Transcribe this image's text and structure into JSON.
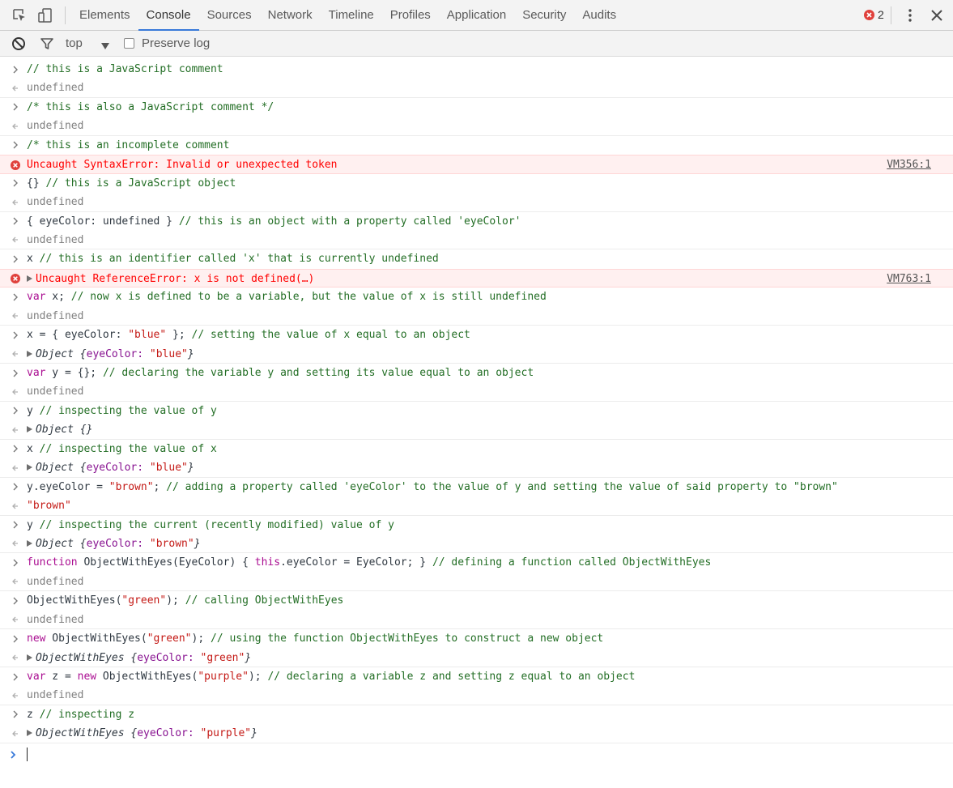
{
  "tabs": [
    {
      "label": "Elements"
    },
    {
      "label": "Console",
      "selected": true
    },
    {
      "label": "Sources"
    },
    {
      "label": "Network"
    },
    {
      "label": "Timeline"
    },
    {
      "label": "Profiles"
    },
    {
      "label": "Application"
    },
    {
      "label": "Security"
    },
    {
      "label": "Audits"
    }
  ],
  "error_count": "2",
  "toolbar": {
    "context": "top",
    "preserve_log_label": "Preserve log",
    "preserve_log_checked": false
  },
  "colors": {
    "accent": "#3879d9",
    "comment": "#236e25",
    "keyword": "#aa0d91",
    "string": "#c41a16",
    "error": "#ff0000",
    "error_bg": "#fff0f0"
  },
  "icons": [
    "inspect-icon",
    "device-toolbar-icon",
    "error-icon",
    "more-icon",
    "close-icon",
    "clear-console-icon",
    "filter-icon",
    "dropdown-icon",
    "input-chevron-icon",
    "result-arrow-icon",
    "expand-triangle-icon"
  ],
  "console": [
    {
      "kind": "input",
      "parts": [
        {
          "t": "// this is a JavaScript comment",
          "c": "cmt"
        }
      ]
    },
    {
      "kind": "result",
      "parts": [
        {
          "t": "undefined",
          "c": "und"
        }
      ]
    },
    {
      "kind": "input",
      "parts": [
        {
          "t": "/* this is also a JavaScript comment */",
          "c": "cmt"
        }
      ]
    },
    {
      "kind": "result",
      "parts": [
        {
          "t": "undefined",
          "c": "und"
        }
      ]
    },
    {
      "kind": "input",
      "parts": [
        {
          "t": "/* this is an incomplete comment",
          "c": "cmt"
        }
      ]
    },
    {
      "kind": "error",
      "parts": [
        {
          "t": "Uncaught SyntaxError: Invalid or unexpected token",
          "c": "err"
        }
      ],
      "link": "VM356:1"
    },
    {
      "kind": "input",
      "parts": [
        {
          "t": "{} ",
          "c": "plain"
        },
        {
          "t": "// this is a JavaScript object",
          "c": "cmt"
        }
      ]
    },
    {
      "kind": "result",
      "parts": [
        {
          "t": "undefined",
          "c": "und"
        }
      ]
    },
    {
      "kind": "input",
      "parts": [
        {
          "t": "{ eyeColor: undefined } ",
          "c": "plain"
        },
        {
          "t": "// this is an object with a property called 'eyeColor'",
          "c": "cmt"
        }
      ]
    },
    {
      "kind": "result",
      "parts": [
        {
          "t": "undefined",
          "c": "und"
        }
      ]
    },
    {
      "kind": "input",
      "parts": [
        {
          "t": "x ",
          "c": "plain"
        },
        {
          "t": "// this is an identifier called 'x' that is currently undefined",
          "c": "cmt"
        }
      ]
    },
    {
      "kind": "error",
      "expandable": true,
      "parts": [
        {
          "t": "Uncaught ReferenceError: x is not defined(…)",
          "c": "err"
        }
      ],
      "link": "VM763:1"
    },
    {
      "kind": "input",
      "parts": [
        {
          "t": "var",
          "c": "kw"
        },
        {
          "t": " x; ",
          "c": "plain"
        },
        {
          "t": "// now x is defined to be a variable, but the value of x is still undefined",
          "c": "cmt"
        }
      ]
    },
    {
      "kind": "result",
      "parts": [
        {
          "t": "undefined",
          "c": "und"
        }
      ]
    },
    {
      "kind": "input",
      "parts": [
        {
          "t": "x = { eyeColor: ",
          "c": "plain"
        },
        {
          "t": "\"blue\"",
          "c": "str"
        },
        {
          "t": " }; ",
          "c": "plain"
        },
        {
          "t": "// setting the value of x equal to an object",
          "c": "cmt"
        }
      ]
    },
    {
      "kind": "result",
      "expandable": true,
      "parts": [
        {
          "t": "Object ",
          "c": "cls"
        },
        {
          "t": "{",
          "c": "brace"
        },
        {
          "t": "eyeColor: ",
          "c": "prop"
        },
        {
          "t": "\"blue\"",
          "c": "str"
        },
        {
          "t": "}",
          "c": "brace"
        }
      ]
    },
    {
      "kind": "input",
      "parts": [
        {
          "t": "var",
          "c": "kw"
        },
        {
          "t": " y = {}; ",
          "c": "plain"
        },
        {
          "t": "// declaring the variable y and setting its value equal to an object",
          "c": "cmt"
        }
      ]
    },
    {
      "kind": "result",
      "parts": [
        {
          "t": "undefined",
          "c": "und"
        }
      ]
    },
    {
      "kind": "input",
      "parts": [
        {
          "t": "y ",
          "c": "plain"
        },
        {
          "t": "// inspecting the value of y",
          "c": "cmt"
        }
      ]
    },
    {
      "kind": "result",
      "expandable": true,
      "parts": [
        {
          "t": "Object {}",
          "c": "cls"
        }
      ]
    },
    {
      "kind": "input",
      "parts": [
        {
          "t": "x ",
          "c": "plain"
        },
        {
          "t": "// inspecting the value of x",
          "c": "cmt"
        }
      ]
    },
    {
      "kind": "result",
      "expandable": true,
      "parts": [
        {
          "t": "Object ",
          "c": "cls"
        },
        {
          "t": "{",
          "c": "brace"
        },
        {
          "t": "eyeColor: ",
          "c": "prop"
        },
        {
          "t": "\"blue\"",
          "c": "str"
        },
        {
          "t": "}",
          "c": "brace"
        }
      ]
    },
    {
      "kind": "input",
      "parts": [
        {
          "t": "y.eyeColor = ",
          "c": "plain"
        },
        {
          "t": "\"brown\"",
          "c": "str"
        },
        {
          "t": "; ",
          "c": "plain"
        },
        {
          "t": "// adding a property called 'eyeColor' to the value of y and setting the value of said property to \"brown\"",
          "c": "cmt"
        }
      ]
    },
    {
      "kind": "result",
      "parts": [
        {
          "t": "\"brown\"",
          "c": "str"
        }
      ]
    },
    {
      "kind": "input",
      "parts": [
        {
          "t": "y ",
          "c": "plain"
        },
        {
          "t": "// inspecting the current (recently modified) value of y",
          "c": "cmt"
        }
      ]
    },
    {
      "kind": "result",
      "expandable": true,
      "parts": [
        {
          "t": "Object ",
          "c": "cls"
        },
        {
          "t": "{",
          "c": "brace"
        },
        {
          "t": "eyeColor: ",
          "c": "prop"
        },
        {
          "t": "\"brown\"",
          "c": "str"
        },
        {
          "t": "}",
          "c": "brace"
        }
      ]
    },
    {
      "kind": "input",
      "parts": [
        {
          "t": "function",
          "c": "kw"
        },
        {
          "t": " ObjectWithEyes(EyeColor) { ",
          "c": "plain"
        },
        {
          "t": "this",
          "c": "kw"
        },
        {
          "t": ".eyeColor = EyeColor; } ",
          "c": "plain"
        },
        {
          "t": "// defining a function called ObjectWithEyes",
          "c": "cmt"
        }
      ]
    },
    {
      "kind": "result",
      "parts": [
        {
          "t": "undefined",
          "c": "und"
        }
      ]
    },
    {
      "kind": "input",
      "parts": [
        {
          "t": "ObjectWithEyes(",
          "c": "plain"
        },
        {
          "t": "\"green\"",
          "c": "str"
        },
        {
          "t": "); ",
          "c": "plain"
        },
        {
          "t": "// calling ObjectWithEyes",
          "c": "cmt"
        }
      ]
    },
    {
      "kind": "result",
      "parts": [
        {
          "t": "undefined",
          "c": "und"
        }
      ]
    },
    {
      "kind": "input",
      "parts": [
        {
          "t": "new",
          "c": "kw"
        },
        {
          "t": " ObjectWithEyes(",
          "c": "plain"
        },
        {
          "t": "\"green\"",
          "c": "str"
        },
        {
          "t": "); ",
          "c": "plain"
        },
        {
          "t": "// using the function ObjectWithEyes to construct a new object",
          "c": "cmt"
        }
      ]
    },
    {
      "kind": "result",
      "expandable": true,
      "parts": [
        {
          "t": "ObjectWithEyes ",
          "c": "cls"
        },
        {
          "t": "{",
          "c": "brace"
        },
        {
          "t": "eyeColor: ",
          "c": "prop"
        },
        {
          "t": "\"green\"",
          "c": "str"
        },
        {
          "t": "}",
          "c": "brace"
        }
      ]
    },
    {
      "kind": "input",
      "parts": [
        {
          "t": "var",
          "c": "kw"
        },
        {
          "t": " z = ",
          "c": "plain"
        },
        {
          "t": "new",
          "c": "kw"
        },
        {
          "t": " ObjectWithEyes(",
          "c": "plain"
        },
        {
          "t": "\"purple\"",
          "c": "str"
        },
        {
          "t": "); ",
          "c": "plain"
        },
        {
          "t": "// declaring a variable z and setting z equal to an object",
          "c": "cmt"
        }
      ]
    },
    {
      "kind": "result",
      "parts": [
        {
          "t": "undefined",
          "c": "und"
        }
      ]
    },
    {
      "kind": "input",
      "parts": [
        {
          "t": "z ",
          "c": "plain"
        },
        {
          "t": "// inspecting z",
          "c": "cmt"
        }
      ]
    },
    {
      "kind": "result",
      "expandable": true,
      "parts": [
        {
          "t": "ObjectWithEyes ",
          "c": "cls"
        },
        {
          "t": "{",
          "c": "brace"
        },
        {
          "t": "eyeColor: ",
          "c": "prop"
        },
        {
          "t": "\"purple\"",
          "c": "str"
        },
        {
          "t": "}",
          "c": "brace"
        }
      ]
    }
  ],
  "prompt": {
    "value": ""
  }
}
